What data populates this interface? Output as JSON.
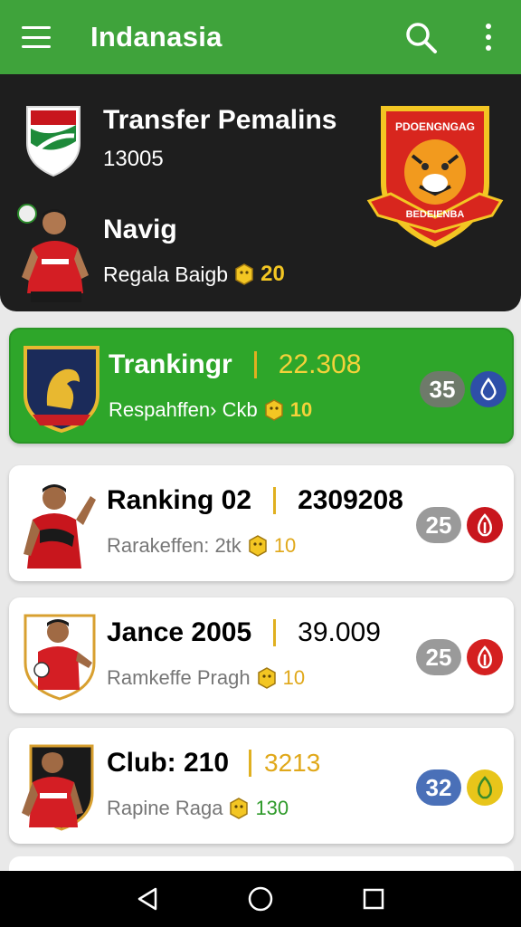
{
  "appbar": {
    "title": "Indanasia",
    "menu_icon": "hamburger-menu-icon",
    "search_icon": "search-icon",
    "more_icon": "more-vert-icon",
    "color": "#3fa33b"
  },
  "hero": {
    "title": "Transfer Pemalins",
    "number": "13005",
    "player_name": "Navig",
    "subtitle": "Regala Baigb",
    "points": "20",
    "crest_text_top": "PDOENGNGAG",
    "crest_text_bottom": "BEDEIENBA"
  },
  "cards": [
    {
      "title": "Trankingr",
      "value": "22.308",
      "sub": "Respahffen› Ckb",
      "points": "10",
      "badge": "35",
      "badge_color": "#6e7a6a",
      "dot_color": "#2e4fa8",
      "highlighted": true,
      "value_color": "#f3d23a",
      "points_color": "#f3d23a"
    },
    {
      "title": "Ranking 02",
      "value": "2309208",
      "sub": "Rarakeffen: 2tk",
      "points": "10",
      "badge": "25",
      "badge_color": "#9a9a9a",
      "dot_color": "#c8161d",
      "highlighted": false,
      "value_color": "#111111",
      "points_color": "#e0a81a"
    },
    {
      "title": "Jance 2005",
      "value": "39.009",
      "sub": "Ramkeffe Pragh",
      "points": "10",
      "badge": "25",
      "badge_color": "#9a9a9a",
      "dot_color": "#d42020",
      "highlighted": false,
      "value_color": "#111111",
      "points_color": "#e0a81a"
    },
    {
      "title": "Club:  210",
      "value": "3213",
      "sub": "Rapine Raga",
      "points": "130",
      "badge": "32",
      "badge_color": "#4a70b8",
      "dot_color": "#e8c51a",
      "highlighted": false,
      "value_color": "#e0a81a",
      "points_color": "#2e9a2a"
    }
  ],
  "navbar": {
    "back_icon": "back-triangle-icon",
    "home_icon": "home-circle-icon",
    "recents_icon": "recents-square-icon"
  }
}
